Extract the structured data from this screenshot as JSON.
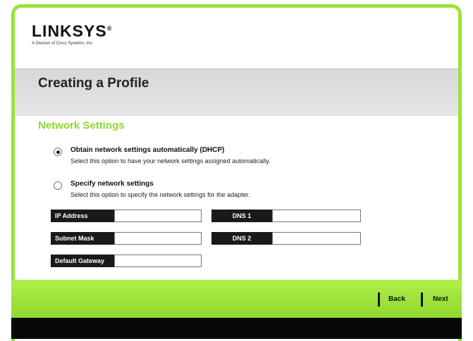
{
  "brand": {
    "name": "LINKSYS",
    "mark": "®",
    "tagline": "A Division of Cisco Systems, Inc."
  },
  "page": {
    "title": "Creating a Profile"
  },
  "section": {
    "title": "Network Settings"
  },
  "options": [
    {
      "label": "Obtain network settings automatically (DHCP)",
      "description": "Select this option to have your network settings assigned automatically.",
      "selected": true
    },
    {
      "label": "Specify network settings",
      "description": "Select this option to specify the network settings for the adapter.",
      "selected": false
    }
  ],
  "fields": {
    "ip_address": {
      "label": "IP Address",
      "value": ""
    },
    "subnet_mask": {
      "label": "Subnet Mask",
      "value": ""
    },
    "default_gateway": {
      "label": "Default Gateway",
      "value": ""
    },
    "dns1": {
      "label": "DNS 1",
      "value": ""
    },
    "dns2": {
      "label": "DNS 2",
      "value": ""
    }
  },
  "nav": {
    "back": "Back",
    "next": "Next"
  },
  "colors": {
    "accent_green": "#8fd92e",
    "border_green": "#9be23a",
    "label_bg": "#1a1a1a"
  }
}
